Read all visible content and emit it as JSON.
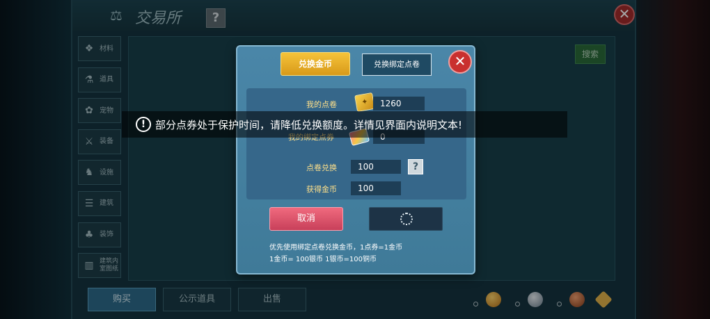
{
  "header": {
    "title": "交易所",
    "help_label": "?",
    "close_label": "✕"
  },
  "sidebar": {
    "items": [
      {
        "label": "材料",
        "icon": "material-icon"
      },
      {
        "label": "道具",
        "icon": "item-icon"
      },
      {
        "label": "宠物",
        "icon": "pet-icon"
      },
      {
        "label": "装备",
        "icon": "equipment-icon"
      },
      {
        "label": "设施",
        "icon": "facility-icon"
      },
      {
        "label": "建筑",
        "icon": "building-icon"
      },
      {
        "label": "装饰",
        "icon": "decoration-icon"
      },
      {
        "label": "建筑内\n室图纸",
        "icon": "blueprint-icon"
      }
    ]
  },
  "search_label": "搜索",
  "bottom_tabs": [
    {
      "label": "购买",
      "active": true
    },
    {
      "label": "公示道具",
      "active": false
    },
    {
      "label": "出售",
      "active": false
    }
  ],
  "dialog": {
    "tab_gold": "兑换金币",
    "tab_bind": "兑换绑定点卷",
    "close_label": "✕",
    "my_ticket_label": "我的点卷",
    "my_ticket_value": "1260",
    "my_bind_label": "我的绑定点券",
    "my_bind_value": "0",
    "exchange_label": "点卷兑换",
    "exchange_value": "100",
    "help_label": "?",
    "gain_label": "获得金币",
    "gain_value": "100",
    "cancel_label": "取消",
    "note_line1": "优先使用绑定点卷兑换金币，1点券=1金币",
    "note_line2": "1金币= 100银币  1银币=100铜币"
  },
  "toast": {
    "icon": "!",
    "text": "部分点券处于保护时间，请降低兑换额度。详情见界面内说明文本!"
  },
  "colors": {
    "gold_tab": "#f5c33a",
    "cancel": "#e0566e",
    "dialog_bg": "#4a86a8"
  }
}
